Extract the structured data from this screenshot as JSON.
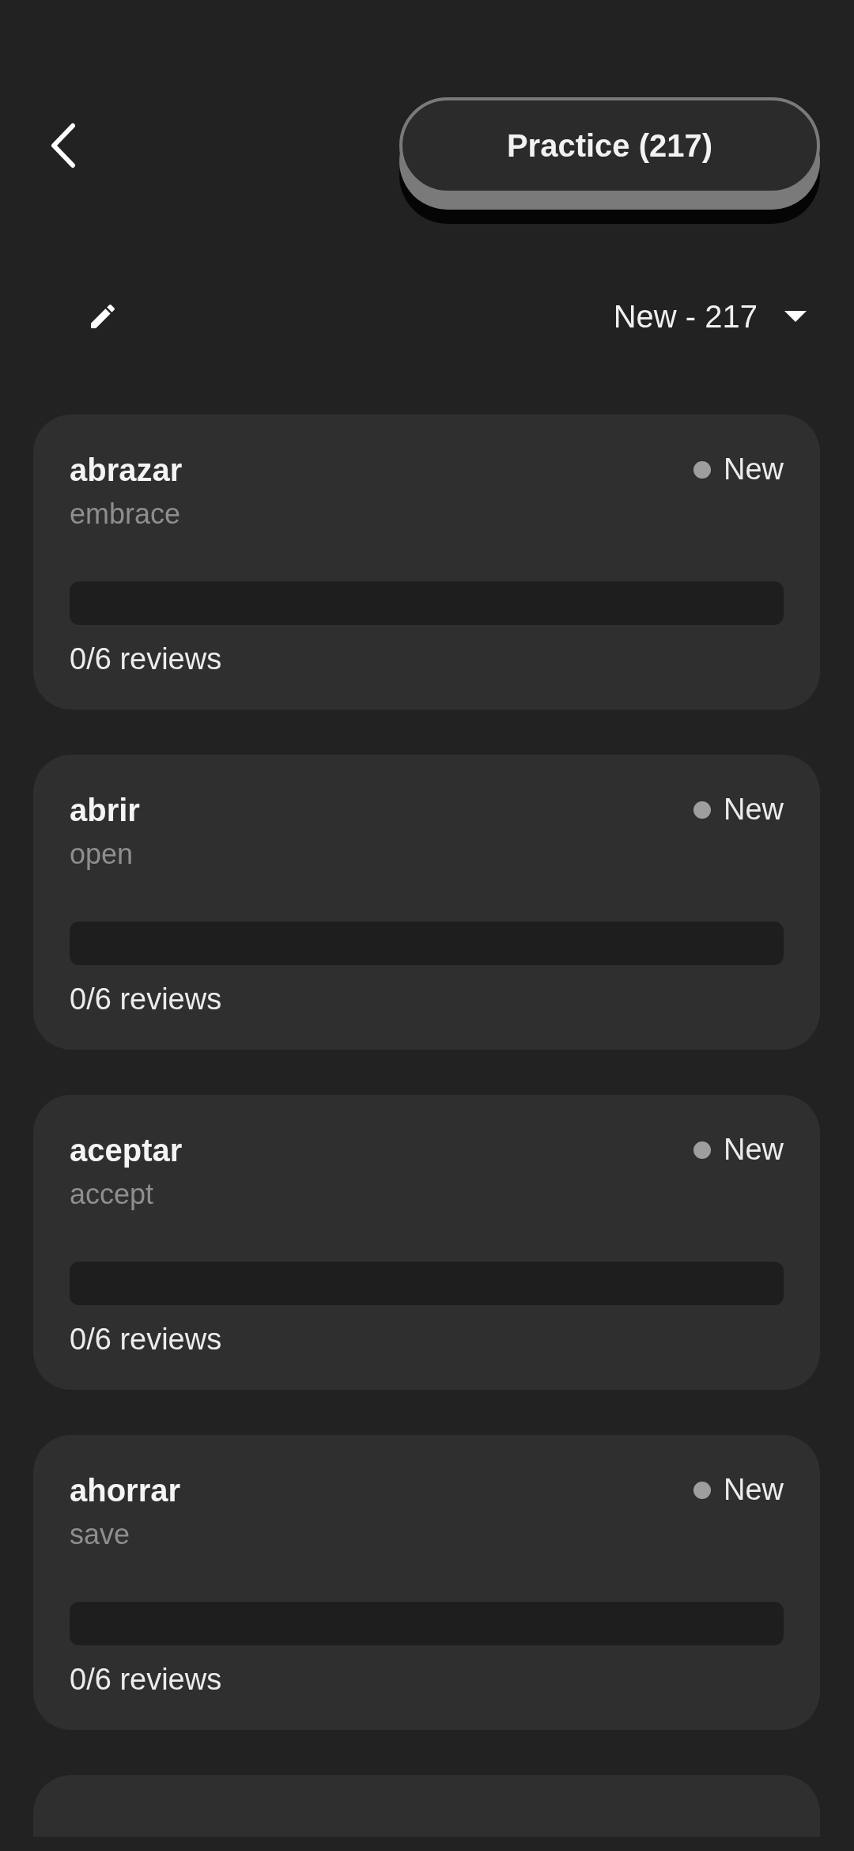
{
  "header": {
    "practice_button": "Practice (217)"
  },
  "filter": {
    "label": "New - 217"
  },
  "cards": [
    {
      "word": "abrazar",
      "translation": "embrace",
      "status": "New",
      "level": 0,
      "reviews": "0/6 reviews"
    },
    {
      "word": "abrir",
      "translation": "open",
      "status": "New",
      "level": 0,
      "reviews": "0/6 reviews"
    },
    {
      "word": "aceptar",
      "translation": "accept",
      "status": "New",
      "level": 0,
      "reviews": "0/6 reviews"
    },
    {
      "word": "ahorrar",
      "translation": "save",
      "status": "New",
      "level": 0,
      "reviews": "0/6 reviews"
    },
    {
      "kind": "partial"
    }
  ]
}
